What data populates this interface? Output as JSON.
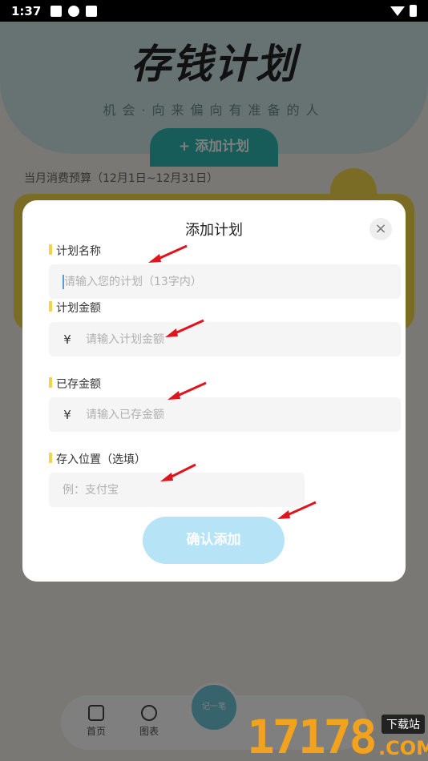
{
  "status_bar": {
    "time": "1:37"
  },
  "background": {
    "hero_title": "存钱计划",
    "hero_subtitle": "机会·向来偏向有准备的人",
    "add_plan_button": "+ 添加计划",
    "budget_label": "当月消费预算（12月1日~12月31日）",
    "nav": {
      "home": "首页",
      "chart": "图表",
      "center": "记一笔"
    }
  },
  "dialog": {
    "title": "添加计划",
    "close_label": "×",
    "fields": {
      "plan_name": {
        "label": "计划名称",
        "placeholder": "请输入您的计划（13字内）"
      },
      "plan_amount": {
        "label": "计划金额",
        "prefix": "¥",
        "placeholder": "请输入计划金额"
      },
      "saved_amount": {
        "label": "已存金额",
        "prefix": "¥",
        "placeholder": "请输入已存金额"
      },
      "location": {
        "label": "存入位置（选填）",
        "placeholder": "例：支付宝"
      }
    },
    "confirm_button": "确认添加"
  },
  "watermark": {
    "digits": "17178",
    "tag": "下载站",
    "suffix": ".COM"
  },
  "colors": {
    "accent_teal": "#2fb8b0",
    "label_marker": "#f3d34b",
    "confirm_bg": "#b6e3f5",
    "arrow_red": "#e0141c"
  }
}
